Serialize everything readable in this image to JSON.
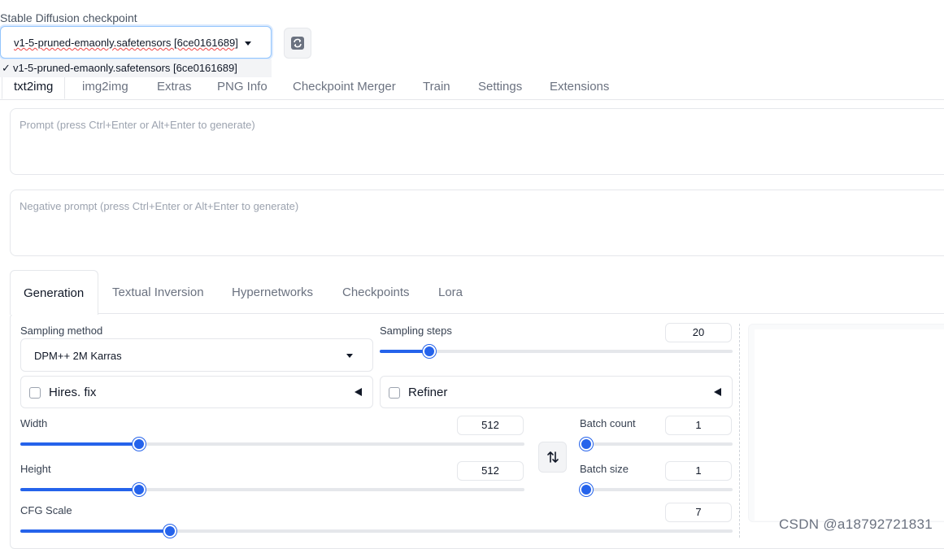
{
  "checkpoint": {
    "label": "Stable Diffusion checkpoint",
    "value": "v1-5-pruned-emaonly.safetensors [6ce0161689]",
    "dropdown_option": "v1-5-pruned-emaonly.safetensors [6ce0161689]",
    "check_glyph": "✓",
    "refresh_icon": "refresh-icon"
  },
  "main_tabs": [
    "txt2img",
    "img2img",
    "Extras",
    "PNG Info",
    "Checkpoint Merger",
    "Train",
    "Settings",
    "Extensions"
  ],
  "prompt": {
    "placeholder": "Prompt (press Ctrl+Enter or Alt+Enter to generate)"
  },
  "negative_prompt": {
    "placeholder": "Negative prompt (press Ctrl+Enter or Alt+Enter to generate)"
  },
  "gen_tabs": [
    "Generation",
    "Textual Inversion",
    "Hypernetworks",
    "Checkpoints",
    "Lora"
  ],
  "sampling": {
    "method_label": "Sampling method",
    "method_value": "DPM++ 2M Karras",
    "steps_label": "Sampling steps",
    "steps_value": "20",
    "steps_fraction": 0.14
  },
  "hires": {
    "label": "Hires.  fix"
  },
  "refiner": {
    "label": "Refiner"
  },
  "width": {
    "label": "Width",
    "value": "512",
    "fraction": 0.235
  },
  "height": {
    "label": "Height",
    "value": "512",
    "fraction": 0.235
  },
  "batch_count": {
    "label": "Batch count",
    "value": "1",
    "fraction": 0
  },
  "batch_size": {
    "label": "Batch size",
    "value": "1",
    "fraction": 0
  },
  "cfg": {
    "label": "CFG Scale",
    "value": "7",
    "fraction": 0.21
  },
  "watermark": "CSDN @a18792721831",
  "colors": {
    "accent": "#2563eb",
    "track": "#e5e7eb",
    "border": "#e5e7eb"
  }
}
